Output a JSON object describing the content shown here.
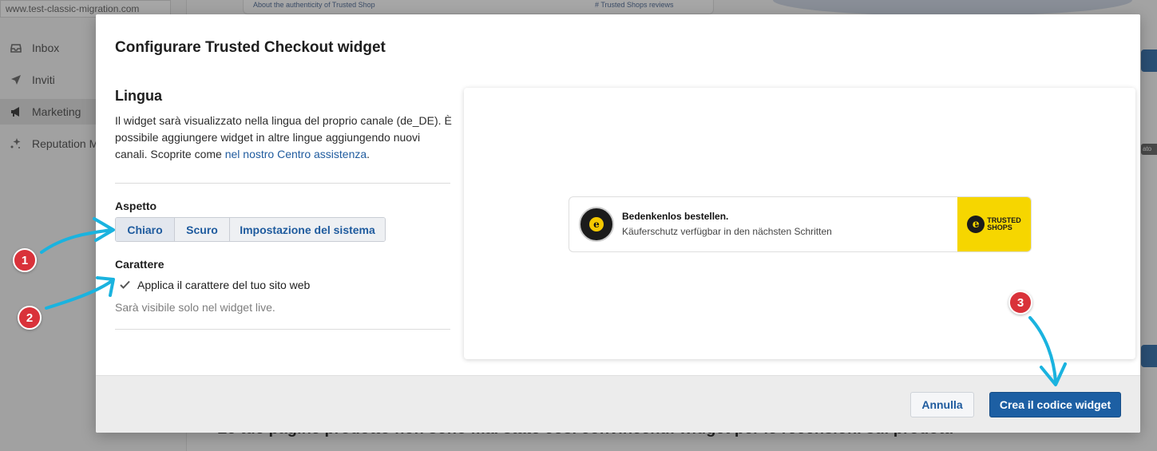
{
  "background": {
    "url": "www.test-classic-migration.com",
    "nav": [
      {
        "label": "Inbox",
        "icon": "inbox-icon"
      },
      {
        "label": "Inviti",
        "icon": "send-icon"
      },
      {
        "label": "Marketing",
        "icon": "megaphone-icon"
      },
      {
        "label": "Reputation M",
        "icon": "sparkles-icon"
      }
    ],
    "top_card_left": "About the authenticity of Trusted Shop",
    "top_card_right": "# Trusted Shops reviews",
    "right_tag": "ato",
    "bottom_text": "Le tue pagine prodotto non sono mai state così convincenti: widget per le recensioni sui prodotti"
  },
  "modal": {
    "title": "Configurare Trusted Checkout widget",
    "language": {
      "heading": "Lingua",
      "text_before_link": "Il widget sarà visualizzato nella lingua del proprio canale (de_DE). È possibile aggiungere widget in altre lingue aggiungendo nuovi canali. Scoprite come ",
      "link": "nel nostro Centro assistenza",
      "text_after_link": "."
    },
    "appearance": {
      "label": "Aspetto",
      "options": [
        "Chiaro",
        "Scuro",
        "Impostazione del sistema"
      ],
      "selected": "Chiaro"
    },
    "font": {
      "label": "Carattere",
      "checkbox_label": "Applica il carattere del tuo sito web",
      "checked": true,
      "hint": "Sarà visibile solo nel widget live."
    },
    "preview": {
      "headline": "Bedenkenlos bestellen.",
      "subline": "Käuferschutz verfügbar in den nächsten Schritten",
      "logo_line1": "TRUSTED",
      "logo_line2": "SHOPS",
      "logo_mark": "e"
    },
    "footer": {
      "cancel": "Annulla",
      "primary": "Crea il codice widget"
    }
  },
  "annotations": [
    "1",
    "2",
    "3"
  ],
  "colors": {
    "accent_blue": "#1d5fa3",
    "link_blue": "#1f5b9e",
    "annotation_red": "#d9323a",
    "arrow_cyan": "#1ab3df",
    "trusted_yellow": "#f6d600"
  }
}
